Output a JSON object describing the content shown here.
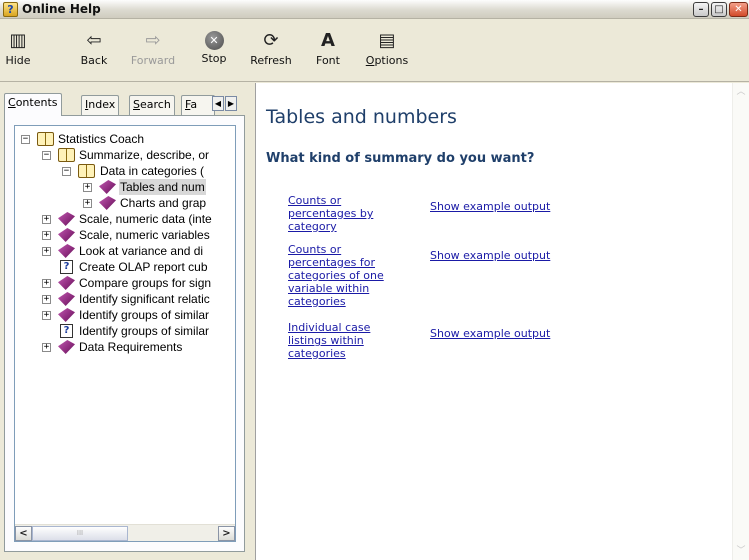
{
  "window": {
    "title": "Online Help"
  },
  "toolbar": {
    "hide": "Hide",
    "back": "Back",
    "forward": "Forward",
    "stop": "Stop",
    "refresh": "Refresh",
    "font": "Font",
    "options_accel": "O",
    "options_rest": "ptions"
  },
  "tabs": [
    {
      "accel": "C",
      "rest": "ontents"
    },
    {
      "accel": "I",
      "rest": "ndex"
    },
    {
      "accel": "S",
      "rest": "earch"
    },
    {
      "accel": "F",
      "rest": "a"
    }
  ],
  "tree": [
    "Statistics Coach",
    "Summarize, describe, or",
    "Data in categories (",
    "Tables and num",
    "Charts and grap",
    "Scale, numeric data (inte",
    "Scale, numeric variables",
    "Look at variance and di",
    "Create OLAP report cub",
    "Compare groups for sign",
    "Identify significant relatic",
    "Identify groups of similar",
    "Identify groups of similar",
    "Data Requirements"
  ],
  "hscroll_grip": "III",
  "content": {
    "title": "Tables and numbers",
    "subtitle": "What kind of summary do you want?",
    "options": [
      {
        "line1": "Counts or",
        "line2": "percentages by",
        "line3": "category",
        "line4": "",
        "line5": "",
        "example": "Show example output"
      },
      {
        "line1": "Counts or",
        "line2": "percentages for",
        "line3": "categories of one",
        "line4": "variable within",
        "line5": "categories",
        "example": "Show example output"
      },
      {
        "line1": "Individual case",
        "line2": "listings within",
        "line3": "categories",
        "line4": "",
        "line5": "",
        "example": "Show example output"
      }
    ]
  },
  "icons": {
    "app": "help-book-icon",
    "hide": "hide-pane-icon",
    "back": "back-arrow-icon",
    "forward": "forward-arrow-icon",
    "stop": "stop-icon",
    "refresh": "refresh-icon",
    "font": "font-icon",
    "options": "options-icon",
    "book": "book-icon",
    "open_book": "open-book-icon",
    "topic": "help-topic-icon"
  },
  "colors": {
    "link": "#1a1aa6",
    "heading": "#1f3f6a",
    "chrome": "#ece9d8"
  }
}
